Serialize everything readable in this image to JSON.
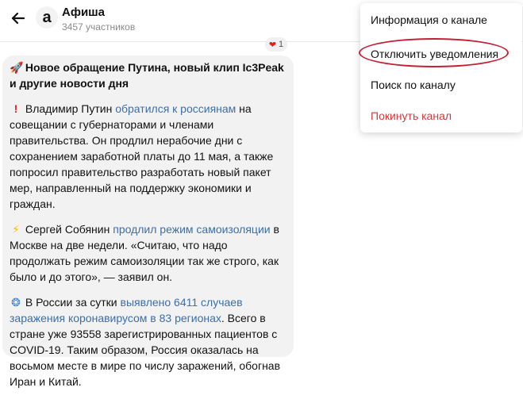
{
  "header": {
    "avatar_letter": "a",
    "title": "Афиша",
    "subtitle": "3457 участников"
  },
  "reaction": {
    "icon": "heart-icon",
    "count": "1"
  },
  "message": {
    "lead": "Новое обращение Путина, новый клип Ic3Peak и другие новости дня",
    "p1_text_before": "Владимир Путин ",
    "p1_link": "обратился к россиянам",
    "p1_text_after": " на совещании с губернаторами и членами правительства. Он продлил нерабочие дни с сохранением заработной платы до 11 мая, а также попросил правительство разработать новый пакет мер, направленный на поддержку экономики и граждан.",
    "p2_text_before": "Сергей Собянин ",
    "p2_link": "продлил режим самоизоляции",
    "p2_text_after": " в Москве на две недели. «Считаю, что надо продолжать режим самоизоляции так же строго, как было и до этого», — заявил он.",
    "p3_text_before": "В России за сутки ",
    "p3_link": "выявлено 6411 случаев заражения коронавирусом в 83 регионах",
    "p3_text_after": ". Всего в стране уже 93558 зарегистрированных пациентов с COVID-19. Таким образом, Россия оказалась на восьмом месте в мире по числу заражений, обогнав Иран и Китай."
  },
  "menu": {
    "items": [
      {
        "label": "Информация о канале"
      },
      {
        "label": "Отключить уведомления"
      },
      {
        "label": "Поиск по каналу"
      },
      {
        "label": "Покинуть канал"
      }
    ]
  },
  "colors": {
    "link": "#3a6fa8",
    "danger": "#d3393d",
    "highlight_oval": "#c81e32"
  }
}
